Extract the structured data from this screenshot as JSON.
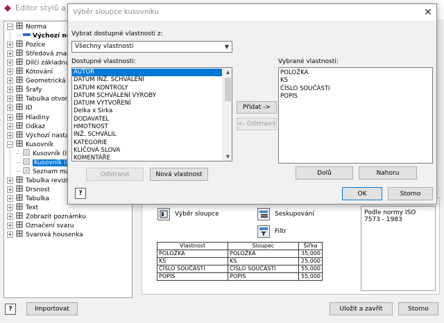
{
  "background": {
    "title": "Editor stylů a nor",
    "tree": [
      {
        "label": "Norma",
        "level": 0,
        "expander": "-",
        "icon": "norma-icon"
      },
      {
        "label": "Výchozí nor",
        "level": 1,
        "expander": "",
        "icon": "bar-icon",
        "bold": true
      },
      {
        "label": "Pozice",
        "level": 0,
        "expander": "+",
        "icon": "pozice-icon"
      },
      {
        "label": "Středová značka",
        "level": 0,
        "expander": "+",
        "icon": "centermark-icon"
      },
      {
        "label": "Dílčí základna",
        "level": 0,
        "expander": "+",
        "icon": "datum-icon"
      },
      {
        "label": "Kótování",
        "level": 0,
        "expander": "+",
        "icon": "dimension-icon"
      },
      {
        "label": "Geometrická tole",
        "level": 0,
        "expander": "+",
        "icon": "tolerance-icon"
      },
      {
        "label": "Šrafy",
        "level": 0,
        "expander": "+",
        "icon": "hatch-icon"
      },
      {
        "label": "Tabulka otvorů",
        "level": 0,
        "expander": "+",
        "icon": "holetable-icon"
      },
      {
        "label": "ID",
        "level": 0,
        "expander": "+",
        "icon": "id-icon"
      },
      {
        "label": "Hladiny",
        "level": 0,
        "expander": "+",
        "icon": "layers-icon"
      },
      {
        "label": "Odkaz",
        "level": 0,
        "expander": "+",
        "icon": "leader-icon"
      },
      {
        "label": "Výchozí nastave",
        "level": 0,
        "expander": "+",
        "icon": "defaults-icon"
      },
      {
        "label": "Kusovník",
        "level": 0,
        "expander": "-",
        "icon": "partslist-icon"
      },
      {
        "label": "Kusovník (ISO",
        "level": 1,
        "expander": "",
        "icon": "doc-icon"
      },
      {
        "label": "Kusovník (IS",
        "level": 1,
        "expander": "",
        "icon": "doc-icon",
        "selected": true
      },
      {
        "label": "Seznam mat",
        "level": 1,
        "expander": "",
        "icon": "doc-icon"
      },
      {
        "label": "Tabulka revizí",
        "level": 0,
        "expander": "+",
        "icon": "revtable-icon"
      },
      {
        "label": "Drsnost",
        "level": 0,
        "expander": "+",
        "icon": "surface-icon"
      },
      {
        "label": "Tabulka",
        "level": 0,
        "expander": "+",
        "icon": "table-icon"
      },
      {
        "label": "Text",
        "level": 0,
        "expander": "+",
        "icon": "text-icon"
      },
      {
        "label": "Zobrazit poznámku",
        "level": 0,
        "expander": "+",
        "icon": "note-icon"
      },
      {
        "label": "Označení svaru",
        "level": 0,
        "expander": "+",
        "icon": "weld-icon"
      },
      {
        "label": "Svarová housenka",
        "level": 0,
        "expander": "+",
        "icon": "weldbead-icon"
      }
    ],
    "tools": {
      "column_chooser": "Výběr sloupce",
      "grouping": "Seskupování",
      "filter": "Filtr"
    },
    "table": {
      "headers": [
        "Vlastnost",
        "Sloupec",
        "Šířka"
      ],
      "rows": [
        [
          "POLOŽKA",
          "POLOŽKA",
          "35,000"
        ],
        [
          "KS",
          "KS",
          "25,000"
        ],
        [
          "ČÍSLO SOUČÁSTI",
          "ČÍSLO SOUČÁSTI",
          "55,000"
        ],
        [
          "POPIS",
          "POPIS",
          "55,000"
        ]
      ]
    },
    "norm_text": "Podle normy ISO 7573 - 1983",
    "bottom": {
      "import": "Importovat",
      "save_close": "Uložit a zavřít",
      "cancel": "Storno"
    }
  },
  "dialog": {
    "title": "Výběr sloupce kusovníku",
    "source_label": "Vybrat dostupné vlastnosti z:",
    "source_value": "Všechny vlastnosti",
    "available_label": "Dostupné vlastnosti:",
    "available": [
      "AUTOR",
      "DATUM INŽ. SCHVÁLENÍ",
      "DATUM KONTROLY",
      "DATUM SCHVÁLENÍ VÝROBY",
      "DATUM VYTVOŘENÍ",
      "Delka x Sirka",
      "DODAVATEL",
      "HMOTNOST",
      "INŽ. SCHVÁLIL",
      "KATEGORIE",
      "KLÍČOVÁ SLOVA",
      "KOMENTÁŘE"
    ],
    "selected_label": "Vybrané vlastnosti:",
    "selected": [
      "POLOŽKA",
      "KS",
      "ČÍSLO SOUČÁSTI",
      "POPIS"
    ],
    "add": "Přidat ->",
    "remove_arrow": "<- Odstranit",
    "remove": "Odstranit",
    "new_property": "Nová vlastnost",
    "down": "Dolů",
    "up": "Nahoru",
    "ok": "OK",
    "cancel": "Storno",
    "help": "?"
  },
  "colors": {
    "selection": "#0078d7",
    "window_bg": "#f0f0f0"
  }
}
